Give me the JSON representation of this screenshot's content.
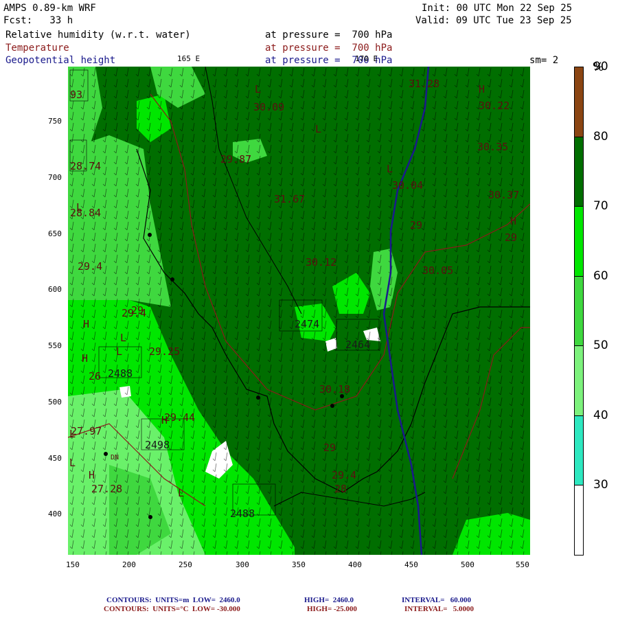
{
  "header": {
    "model": "AMPS 0.89-km WRF",
    "forecast": "Fcst:   33 h",
    "init": "Init: 00 UTC Mon 22 Sep 25",
    "valid": "Valid: 09 UTC Tue 23 Sep 25",
    "field1_name": "Relative humidity (w.r.t. water)",
    "field1_level": "at pressure =  700 hPa",
    "field2_name": "Temperature",
    "field2_level": "at pressure =  700 hPa",
    "field3_name": "Geopotential height",
    "field3_level": "at pressure =  700 hPa",
    "lon_label_1": "165 E",
    "lon_label_2": "170 E",
    "smoothing": "sm= 2"
  },
  "axes": {
    "x_ticks": [
      "150",
      "200",
      "250",
      "300",
      "350",
      "400",
      "450",
      "500",
      "550"
    ],
    "y_ticks": [
      "750",
      "700",
      "650",
      "600",
      "550",
      "500",
      "450",
      "400"
    ]
  },
  "colorbar": {
    "unit": "%",
    "levels": [
      "30",
      "40",
      "50",
      "60",
      "70",
      "80",
      "90"
    ],
    "colors": [
      "#ffffff",
      "#2ee8c0",
      "#7df27d",
      "#3fd83f",
      "#00e600",
      "#006e00",
      "#8b4513"
    ]
  },
  "map_labels": {
    "values": [
      "93",
      "28.74",
      "28.84",
      "29.4",
      "29.4",
      "29",
      "29.25",
      "2488",
      "26",
      "27.97",
      "2498",
      "29.44",
      "27.28",
      "30.09",
      "29.87",
      "31.67",
      "30.12",
      "29",
      "30.04",
      "30.35",
      "30.37",
      "29",
      "30.05",
      "2474",
      "2464",
      "30.18",
      "2488",
      "29",
      "29.4",
      "28",
      "31.28",
      "30.22",
      "DN"
    ],
    "pressure_systems": [
      "L",
      "H",
      "L",
      "H",
      "L",
      "L",
      "H",
      "L",
      "H",
      "L",
      "L",
      "L",
      "L",
      "H",
      "H"
    ]
  },
  "footer": {
    "line1_label": "CONTOURS:  UNITS=m  LOW=  2460.0",
    "line1_high": "HIGH=  2460.0",
    "line1_interval": "INTERVAL=   60.000",
    "line2_label": "CONTOURS:  UNITS=°C  LOW= -30.000",
    "line2_high": "HIGH= -25.000",
    "line2_interval": "INTERVAL=   5.0000"
  }
}
